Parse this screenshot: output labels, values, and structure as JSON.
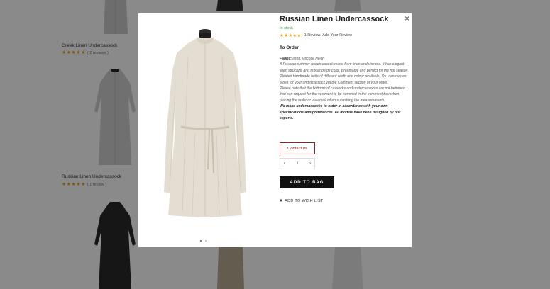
{
  "colors": {
    "accent": "#8e2424",
    "stock": "#3aa845",
    "star": "#e2a01c",
    "button": "#111111"
  },
  "background": {
    "products": [
      {
        "title": "Greek Linen Undercassock",
        "stars": "★★★★★",
        "reviews": "( 2 reviews )"
      },
      {
        "title": "Russian Linen Undercassock",
        "stars": "★★★★★",
        "reviews": "( 1 review )"
      }
    ]
  },
  "modal": {
    "close_icon": "×",
    "product": {
      "title": "Russian Linen Undercassock",
      "stock": "In stock",
      "stars": "★★★★★",
      "review_count": "1 Review",
      "add_review": "Add Your Review",
      "section_title": "To Order",
      "fabric_label": "Fabric:",
      "fabric_value": "linen, viscose rayon",
      "description_1": "A Russian summer undercassock made from linen and viscose. It has elegant linen structure and tender beige color. Breathable and perfect for the hot season. Pleated handmade belts of different width and colour available. You can request a belt for your undercassock via the Comment section of your order.",
      "description_2": "Please note that the bottoms of cassocks and undercassocks are not hemmed. You can request for the vestment to be hemmed in the comment box when placing the order or via email when submitting the measurements.",
      "description_bold": "We make undercassocks to order in accordance with your own specifications and preferences. All models have been designed by our experts.",
      "contact_label": "Contact us",
      "qty_minus": "‹",
      "qty_value": "1",
      "qty_plus": "›",
      "add_to_bag_label": "ADD TO BAG",
      "wish_icon": "heart-icon",
      "wish_label": "ADD TO WISH LIST"
    }
  }
}
